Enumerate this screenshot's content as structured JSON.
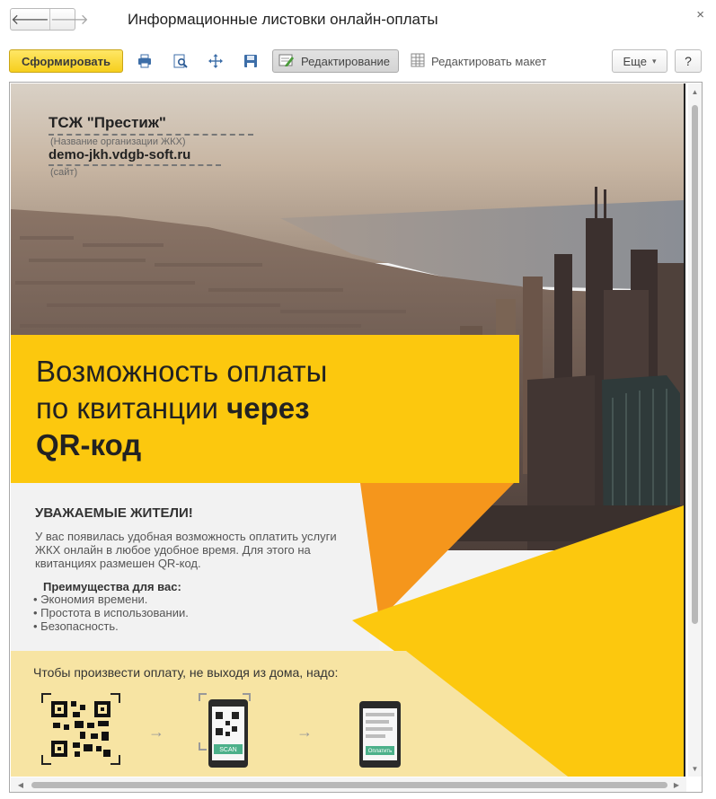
{
  "window": {
    "title": "Информационные листовки онлайн-оплаты",
    "back_icon": "arrow-left-icon",
    "forward_icon": "arrow-right-icon",
    "close_icon": "close-icon"
  },
  "toolbar": {
    "generate_label": "Сформировать",
    "edit_mode_label": "Редактирование",
    "edit_layout_label": "Редактировать макет",
    "more_label": "Еще",
    "more_caret": "▾",
    "help_label": "?",
    "icons": [
      "print-icon",
      "preview-icon",
      "move-icon",
      "save-icon",
      "edit-icon",
      "layout-icon"
    ]
  },
  "document": {
    "org_name": "ТСЖ \"Престиж\"",
    "org_hint": "(Название организации ЖКХ)",
    "site": "demo-jkh.vdgb-soft.ru",
    "site_hint": "(сайт)",
    "headline_line1": "Возможность оплаты",
    "headline_line2_regular": "по квитанции ",
    "headline_line2_bold": "через",
    "headline_line3": "QR-код",
    "greeting": "УВАЖАЕМЫЕ ЖИТЕЛИ!",
    "paragraph": "У вас появилась удобная возможность оплатить услуги ЖКХ онлайн в любое удобное время. Для этого на квитанциях размешен QR-код.",
    "benefits_title": "Преимущества для вас:",
    "benefits": [
      "• Экономия времени.",
      "• Простота в использовании.",
      "• Безопасность."
    ],
    "howto": "Чтобы произвести оплату, не выходя из дома, надо:",
    "scan_label": "SCAN",
    "pay_label": "Оплатить"
  },
  "colors": {
    "accent_yellow": "#fcc80e",
    "orange": "#f5961c",
    "light_band": "#f7e4a3",
    "primary_button": "#f6cf1d"
  }
}
